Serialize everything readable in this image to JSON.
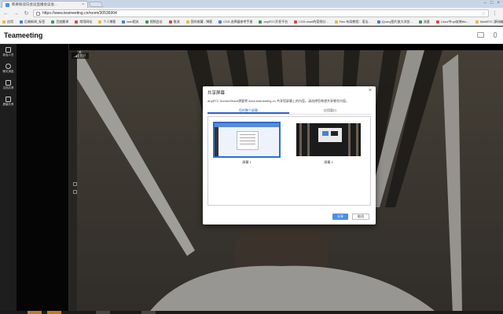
{
  "browser": {
    "tab_title": "和奇粉双向会议直播会议会...",
    "url": "https://www.teameeting.cn/room/30536904",
    "bookmarks": [
      "应用",
      "后端新闻_标签",
      "百度翻译",
      "常用网站",
      "个人博客",
      "web相关",
      "视频会议",
      "推流",
      "我的收藏 - 博客",
      "CSS 选择器参考手册",
      "anyRTC开发平台",
      "CSS reset的案例分...",
      "Flex 布局教程：语法...",
      "jQuery图片放大浏览...",
      "流量",
      "Linux中npf安装ffm...",
      "WebRTC 源码编译..."
    ]
  },
  "app": {
    "brand": "Teameeting",
    "sidebar": [
      {
        "label": "参会人员",
        "icon": "people-icon"
      },
      {
        "label": "聊天消息",
        "icon": "chat-icon"
      },
      {
        "label": "文档共享",
        "icon": "document-icon"
      },
      {
        "label": "屏幕共享",
        "icon": "screen-share-icon"
      }
    ],
    "signal_label": "较好"
  },
  "dialog": {
    "title": "共享屏幕",
    "close_label": "×",
    "description": "anyRTC ScreenShare想要将 www.teameeting.cn 共享您屏幕上的内容。请选择您希望共享哪些内容。",
    "tabs": [
      {
        "label": "您的整个屏幕",
        "active": true
      },
      {
        "label": "应用窗口",
        "active": false
      }
    ],
    "screens": [
      {
        "label": "屏幕 1",
        "selected": true
      },
      {
        "label": "屏幕 2",
        "selected": false
      }
    ],
    "share_button": "分享",
    "cancel_button": "取消"
  },
  "colors": {
    "accent": "#3366cc",
    "primary_button": "#4d8fe8",
    "sidebar_bg": "#1e1e1e"
  }
}
